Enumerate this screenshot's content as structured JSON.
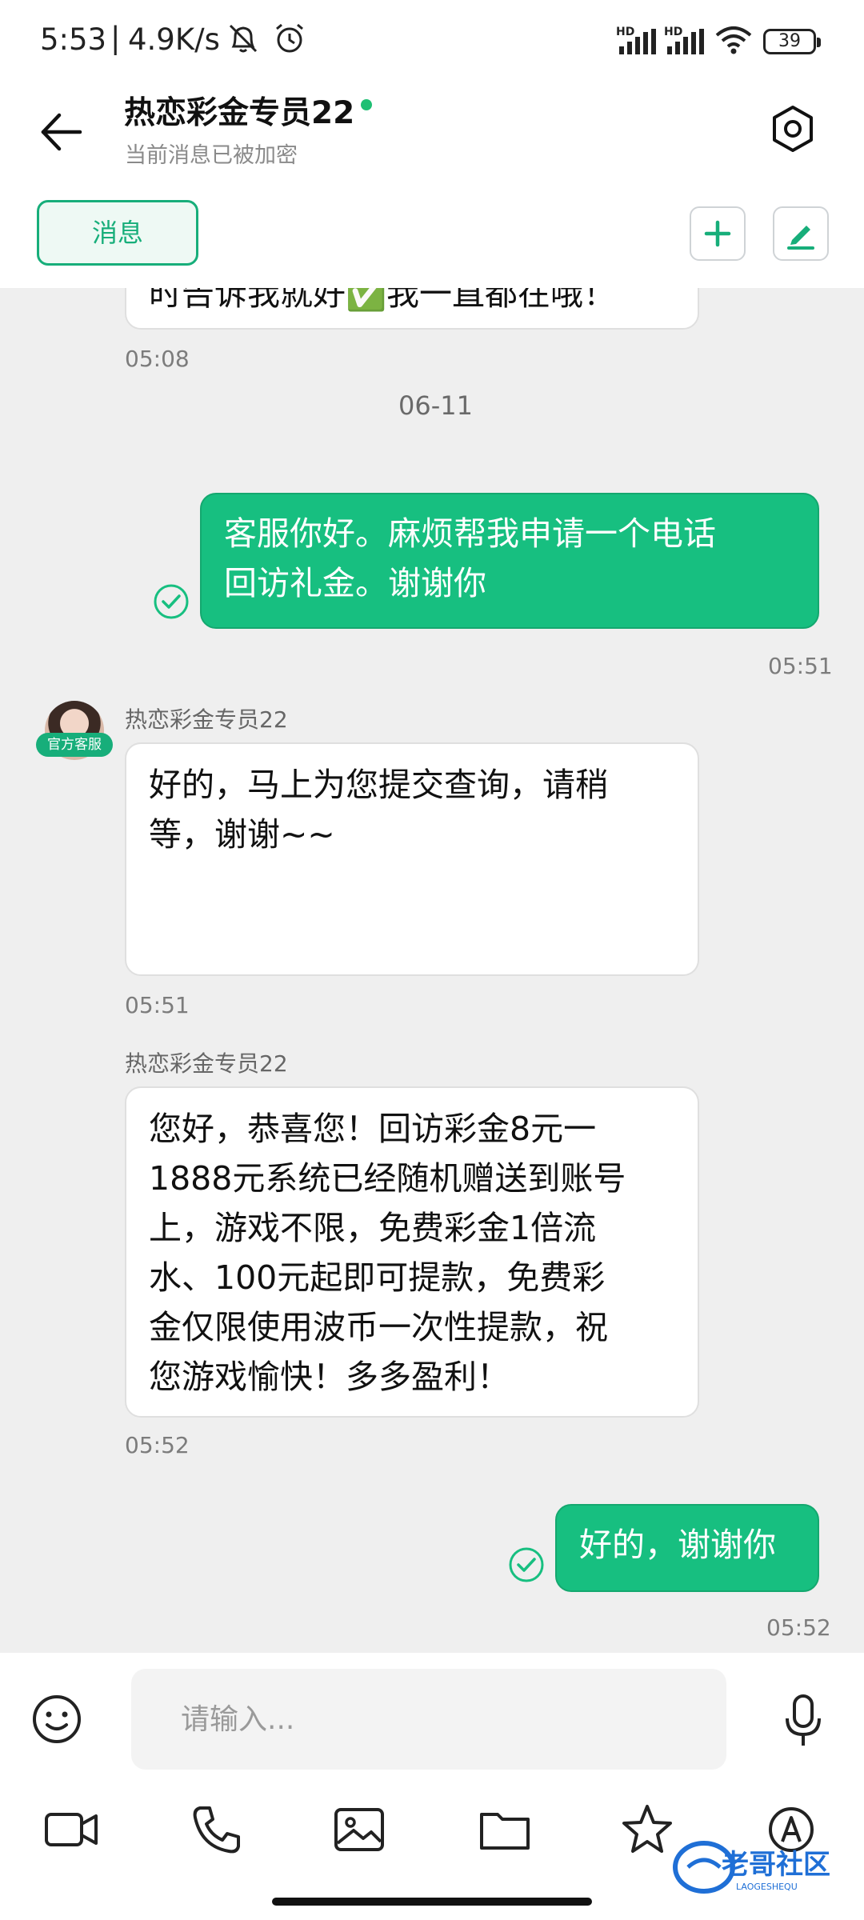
{
  "status_bar": {
    "time": "5:53",
    "separator": "|",
    "net_speed": "4.9K/s",
    "signal_1": "HD",
    "signal_2": "HD",
    "battery": "39",
    "icons": [
      "mute-bell-icon",
      "alarm-icon",
      "signal-icon",
      "signal-icon",
      "wifi-icon",
      "battery-icon"
    ]
  },
  "header": {
    "title": "热恋彩金专员22",
    "subtitle": "当前消息已被加密",
    "online_color": "#1fbf73"
  },
  "tabs": {
    "message_tab": "消息"
  },
  "chat": {
    "clipped_message": "时告诉我就好✅我一直都在哦！",
    "clipped_time": "05:08",
    "date_separator": "06-11",
    "messages": [
      {
        "side": "out",
        "text_line1": "客服你好。麻烦帮我申请一个电话",
        "text_line2": "回访礼金。谢谢你",
        "time": "05:51"
      },
      {
        "side": "in",
        "sender": "热恋彩金专员22",
        "badge": "官方客服",
        "text_line1": "好的，马上为您提交查询，请稍",
        "text_line2": "等，谢谢~~",
        "time": "05:51"
      },
      {
        "side": "in",
        "sender": "热恋彩金专员22",
        "lines": [
          "您好，恭喜您！回访彩金8元一",
          "1888元系统已经随机赠送到账号",
          "上，游戏不限，免费彩金1倍流",
          "水、100元起即可提款，免费彩",
          "金仅限使用波币一次性提款，祝",
          "您游戏愉快！多多盈利！"
        ],
        "time": "05:52"
      },
      {
        "side": "out",
        "text": "好的，谢谢你",
        "time": "05:52"
      }
    ]
  },
  "composer": {
    "placeholder": "请输入..."
  },
  "toolbar": {
    "items": [
      "video-icon",
      "phone-icon",
      "image-icon",
      "folder-icon",
      "star-icon",
      "translate-icon"
    ]
  },
  "watermark": {
    "text": "老哥社区",
    "subtext": "LAOGESHEQU"
  },
  "colors": {
    "accent": "#17bf80",
    "accent_dark": "#17ae7a",
    "chat_bg": "#efefef"
  }
}
